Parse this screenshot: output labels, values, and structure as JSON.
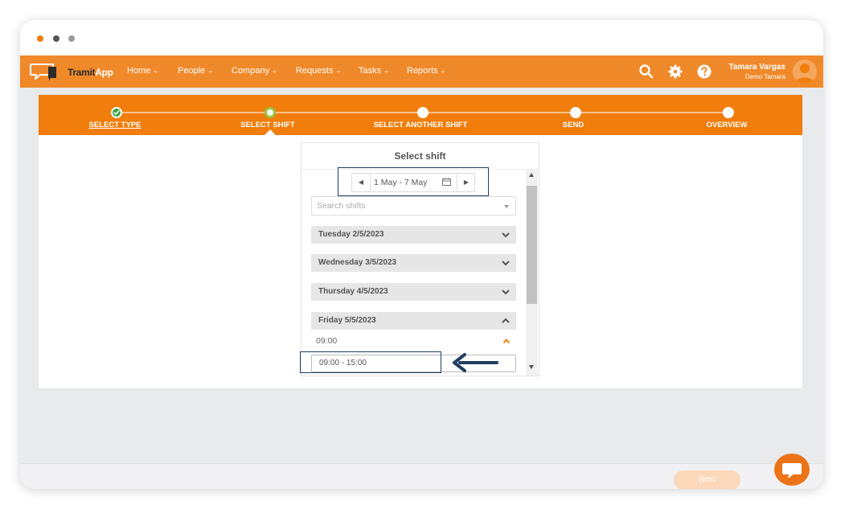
{
  "window": {
    "controls": [
      "close",
      "minimize",
      "maximize"
    ]
  },
  "app": {
    "logo_text_1": "Tramit",
    "logo_text_2": "App"
  },
  "nav": {
    "items": [
      {
        "label": "Home"
      },
      {
        "label": "People"
      },
      {
        "label": "Company"
      },
      {
        "label": "Requests"
      },
      {
        "label": "Tasks"
      },
      {
        "label": "Reports"
      }
    ],
    "icons": [
      "search-icon",
      "gear-icon",
      "help-icon"
    ]
  },
  "user": {
    "name": "Tamara Vargas",
    "subtitle": "Demo Tamara"
  },
  "stepper": {
    "steps": [
      {
        "label": "SELECT TYPE",
        "state": "done"
      },
      {
        "label": "SELECT SHIFT",
        "state": "current"
      },
      {
        "label": "SELECT ANOTHER SHIFT",
        "state": "pending"
      },
      {
        "label": "SEND",
        "state": "pending"
      },
      {
        "label": "OVERVIEW",
        "state": "pending"
      }
    ]
  },
  "select_shift": {
    "title": "Select shift",
    "date_range": "1 May - 7 May",
    "search_placeholder": "Search shifts",
    "days": [
      {
        "label": "Tuesday 2/5/2023",
        "expanded": false
      },
      {
        "label": "Wednesday 3/5/2023",
        "expanded": false
      },
      {
        "label": "Thursday 4/5/2023",
        "expanded": false
      },
      {
        "label": "Friday 5/5/2023",
        "expanded": true
      }
    ],
    "time_group": "09:00",
    "shift_option": "09:00 - 15:00"
  },
  "footer": {
    "next_label": "Next"
  },
  "colors": {
    "brand_orange": "#f07d0c",
    "nav_orange": "#f0892a",
    "highlight_navy": "#223e63",
    "success_green": "#3aa34a"
  }
}
